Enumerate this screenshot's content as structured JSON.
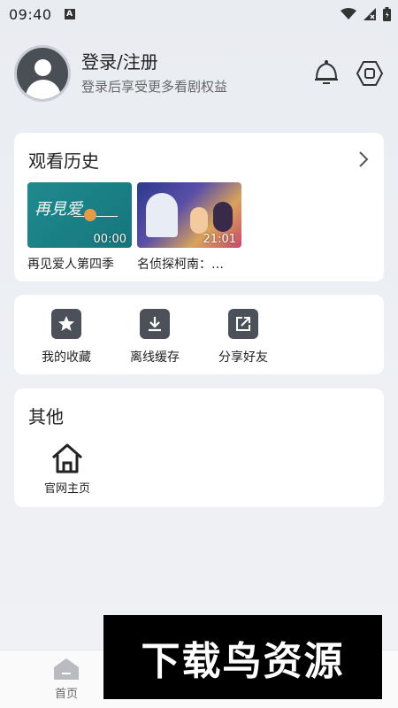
{
  "status_bar": {
    "time": "09:40"
  },
  "profile": {
    "title": "登录/注册",
    "subtitle": "登录后享受更多看剧权益"
  },
  "history": {
    "title": "观看历史",
    "items": [
      {
        "caption": "再见爱人第四季",
        "duration": "00:00"
      },
      {
        "caption": "名侦探柯南：…",
        "duration": "21:01"
      }
    ]
  },
  "actions": [
    {
      "label": "我的收藏",
      "icon": "star-icon"
    },
    {
      "label": "离线缓存",
      "icon": "download-icon"
    },
    {
      "label": "分享好友",
      "icon": "share-icon"
    }
  ],
  "others": {
    "title": "其他",
    "items": [
      {
        "label": "官网主页",
        "icon": "home-icon"
      }
    ]
  },
  "tabbar": {
    "home_label": "首页"
  },
  "watermark": {
    "text": "下载鸟资源"
  },
  "colors": {
    "icon_bg": "#4c5058",
    "text": "#222222",
    "subtext": "#666666"
  }
}
